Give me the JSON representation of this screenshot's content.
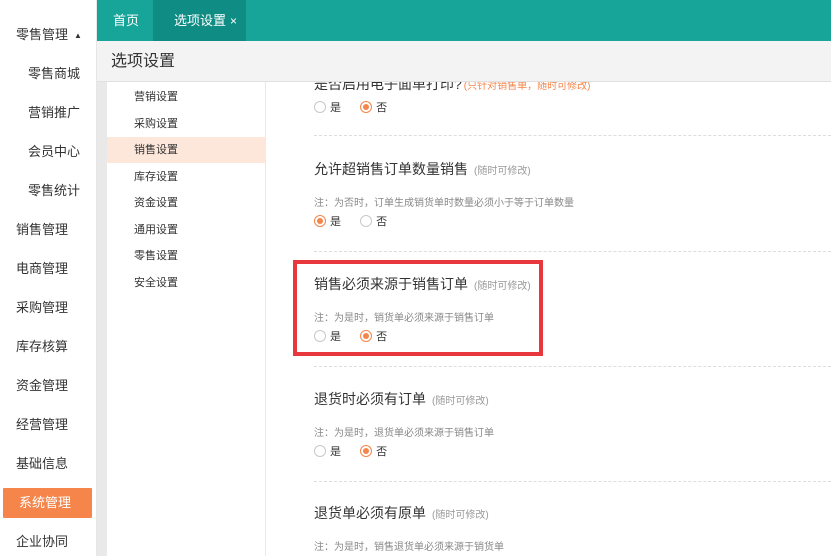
{
  "sidebar": {
    "cut_label": "",
    "items": [
      {
        "label": "零售管理",
        "kind": "top",
        "expanded": true
      },
      {
        "label": "零售商城",
        "kind": "sub"
      },
      {
        "label": "营销推广",
        "kind": "sub"
      },
      {
        "label": "会员中心",
        "kind": "sub"
      },
      {
        "label": "零售统计",
        "kind": "sub"
      },
      {
        "label": "销售管理",
        "kind": "top"
      },
      {
        "label": "电商管理",
        "kind": "top"
      },
      {
        "label": "采购管理",
        "kind": "top"
      },
      {
        "label": "库存核算",
        "kind": "top"
      },
      {
        "label": "资金管理",
        "kind": "top"
      },
      {
        "label": "经营管理",
        "kind": "top"
      },
      {
        "label": "基础信息",
        "kind": "top"
      },
      {
        "label": "系统管理",
        "kind": "top",
        "active": true
      },
      {
        "label": "企业协同",
        "kind": "top"
      }
    ]
  },
  "tabs": {
    "home": "首页",
    "current": "选项设置",
    "close_glyph": "×"
  },
  "page": {
    "title": "选项设置"
  },
  "subnav": [
    {
      "label": "营销设置"
    },
    {
      "label": "采购设置"
    },
    {
      "label": "销售设置",
      "active": true
    },
    {
      "label": "库存设置"
    },
    {
      "label": "资金设置"
    },
    {
      "label": "通用设置"
    },
    {
      "label": "零售设置"
    },
    {
      "label": "安全设置"
    }
  ],
  "sections": {
    "cut": {
      "title": "是否启用电子面单打印?",
      "hint": "(只针对销售单，随时可修改)",
      "options": [
        {
          "label": "是",
          "checked": false
        },
        {
          "label": "否",
          "checked": true
        }
      ]
    },
    "s1": {
      "title": "允许超销售订单数量销售",
      "hint": "(随时可修改)",
      "note": "注：为否时，订单生成销货单时数量必须小于等于订单数量",
      "options": [
        {
          "label": "是",
          "checked": true
        },
        {
          "label": "否",
          "checked": false
        }
      ]
    },
    "s2": {
      "title": "销售必须来源于销售订单",
      "hint": "(随时可修改)",
      "note": "注：为是时，销货单必须来源于销售订单",
      "options": [
        {
          "label": "是",
          "checked": false
        },
        {
          "label": "否",
          "checked": true
        }
      ]
    },
    "s3": {
      "title": "退货时必须有订单",
      "hint": "(随时可修改)",
      "note": "注：为是时，退货单必须来源于销售订单",
      "options": [
        {
          "label": "是",
          "checked": false
        },
        {
          "label": "否",
          "checked": true
        }
      ]
    },
    "s4": {
      "title": "退货单必须有原单",
      "hint": "(随时可修改)",
      "note": "注：为是时，销售退货单必须来源于销货单"
    }
  },
  "colors": {
    "teal": "#17a59a",
    "teal_dark": "#0f8d84",
    "accent": "#f5854a",
    "highlight": "#e8383d"
  }
}
